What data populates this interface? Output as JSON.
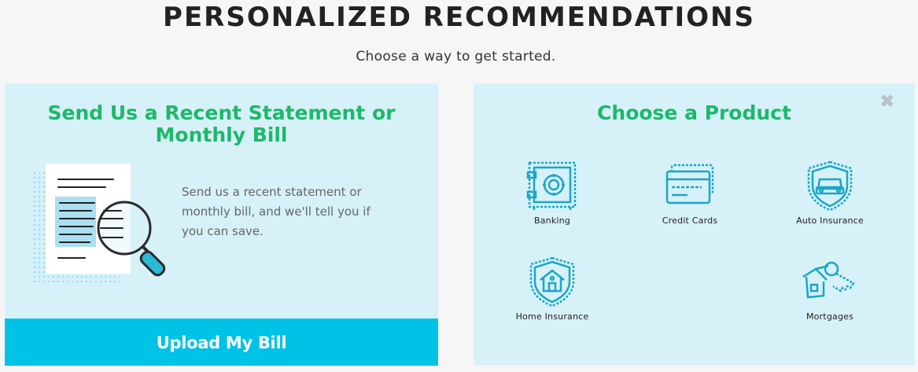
{
  "header": {
    "title": "PERSONALIZED RECOMMENDATIONS",
    "subtitle": "Choose a way to get started."
  },
  "left_panel": {
    "heading": "Send Us a Recent Statement or Monthly Bill",
    "description": "Send us a recent statement or monthly bill, and we'll tell you if you can save.",
    "button_label": "Upload My Bill",
    "illustration_icon": "statement-magnifier-icon"
  },
  "right_panel": {
    "heading": "Choose a Product",
    "close_icon": "close-icon",
    "products": [
      {
        "label": "Banking",
        "icon": "safe-icon"
      },
      {
        "label": "Credit Cards",
        "icon": "credit-card-icon"
      },
      {
        "label": "Auto Insurance",
        "icon": "car-shield-icon"
      },
      {
        "label": "Home Insurance",
        "icon": "house-shield-icon"
      },
      {
        "label": "Mortgages",
        "icon": "house-key-icon"
      }
    ]
  },
  "colors": {
    "accent_green": "#1db86a",
    "button_blue": "#00c2e6",
    "panel_bg": "#d6f1f8",
    "icon_blue": "#1aa6c9"
  }
}
